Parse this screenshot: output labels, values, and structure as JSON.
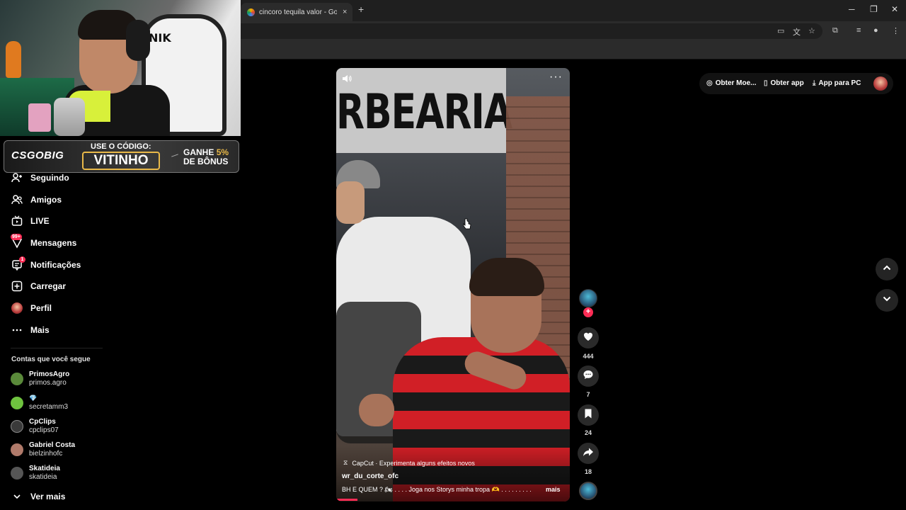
{
  "browser": {
    "tab_title": "cincoro tequila valor - Google S",
    "tab_close": "×",
    "new_tab": "+",
    "win_minimize": "─",
    "win_restore": "❐",
    "win_close": "✕"
  },
  "stream": {
    "cam_chair_text": "NIK",
    "promo_logo": "CSGOBIG",
    "promo_use_code": "USE O CÓDIGO:",
    "promo_code": "VITINHO",
    "promo_gain": "GANHE",
    "promo_percent": "5%",
    "promo_bonus": "DE BÔNUS"
  },
  "sidebar": {
    "items": [
      {
        "label": "Seguindo",
        "icon": "following-icon"
      },
      {
        "label": "Amigos",
        "icon": "friends-icon"
      },
      {
        "label": "LIVE",
        "icon": "live-icon"
      },
      {
        "label": "Mensagens",
        "icon": "messages-icon",
        "badge": "99+"
      },
      {
        "label": "Notificações",
        "icon": "notifications-icon",
        "badge": "1"
      },
      {
        "label": "Carregar",
        "icon": "upload-icon"
      },
      {
        "label": "Perfil",
        "icon": "profile-avatar"
      },
      {
        "label": "Mais",
        "icon": "more-icon"
      }
    ],
    "following_title": "Contas que você segue",
    "accounts": [
      {
        "name": "PrimosAgro",
        "handle": "primos.agro",
        "color": "#5a8a3a"
      },
      {
        "name": "",
        "handle": "secretamm3",
        "color": "#6fc33f"
      },
      {
        "name": "CpClips",
        "handle": "cpclips07",
        "color": "#3a3a3a"
      },
      {
        "name": "Gabriel Costa",
        "handle": "bielzinhofc",
        "color": "#b07a6a"
      },
      {
        "name": "Skatideia",
        "handle": "skatideia",
        "color": "#555555"
      }
    ],
    "see_more": "Ver mais"
  },
  "video": {
    "sign_text": "RBEARIA",
    "capcut_label": "CapCut · Experimenta alguns efeitos novos",
    "author": "wr_du_corte_ofc",
    "description": "BH E QUEM ? 🏍 . . . .  Joga nos Storys minha tropa 🫶 . . . . . . . . .",
    "more_label": "mais"
  },
  "actions": {
    "likes": "444",
    "comments": "7",
    "saves": "24",
    "shares": "18"
  },
  "header": {
    "get_coins": "Obter Moe...",
    "get_app": "Obter app",
    "app_pc": "App para PC"
  },
  "colors": {
    "accent": "#fe2c55",
    "promo_gold": "#e9b949"
  }
}
